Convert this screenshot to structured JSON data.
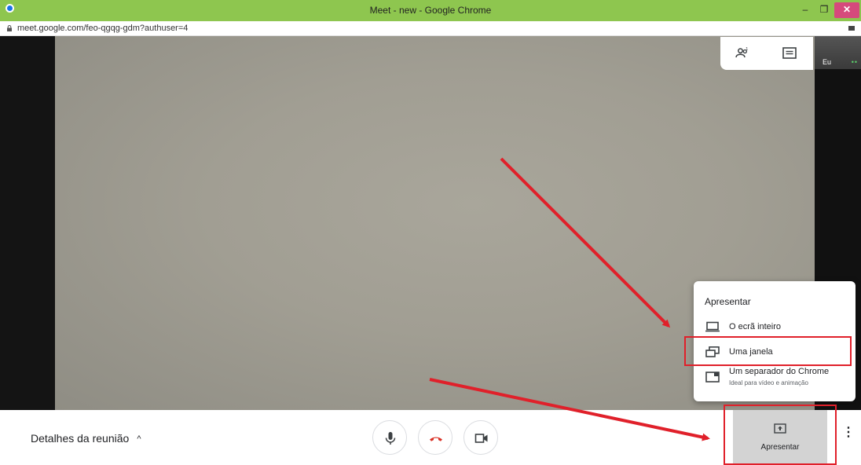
{
  "window": {
    "title": "Meet - new - Google Chrome",
    "min": "–",
    "max": "❐",
    "close": "✕"
  },
  "urlbar": {
    "url": "meet.google.com/feo-qgqg-gdm?authuser=4"
  },
  "topright": {
    "people_count": "1",
    "self_label": "Eu",
    "self_dots": "••"
  },
  "present_menu": {
    "header": "Apresentar",
    "items": [
      {
        "label": "O ecrã inteiro"
      },
      {
        "label": "Uma janela"
      },
      {
        "label": "Um separador do Chrome",
        "sublabel": "Ideal para vídeo e animação"
      }
    ]
  },
  "bottom": {
    "details_label": "Detalhes da reunião",
    "details_chevron": "^",
    "present_label": "Apresentar",
    "more_icon": "⋮"
  },
  "colors": {
    "titlebar": "#8ec64f",
    "annotation_red": "#e0202a",
    "hangup_red": "#d93025",
    "video_gray": "#a19e93"
  }
}
